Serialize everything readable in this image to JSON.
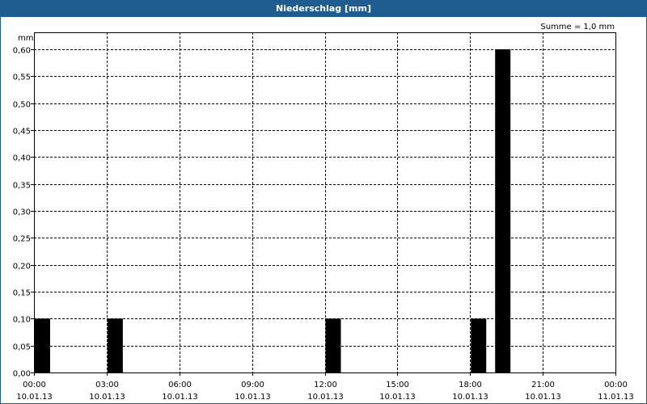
{
  "window": {
    "title": "Niederschlag [mm]"
  },
  "colors": {
    "titlebar": "#1f5d91",
    "bar": "#000000",
    "grid": "#000000"
  },
  "chart_data": {
    "type": "bar",
    "title": "Niederschlag [mm]",
    "ylabel": "mm",
    "annotation": "Summe = 1,0 mm",
    "ylim": [
      0,
      0.6
    ],
    "yticks": [
      "0,00",
      "0,05",
      "0,10",
      "0,15",
      "0,20",
      "0,25",
      "0,30",
      "0,35",
      "0,40",
      "0,45",
      "0,50",
      "0,55",
      "0,60"
    ],
    "xlim_hours": [
      0,
      24
    ],
    "xticks": [
      {
        "time": "00:00",
        "date": "10.01.13"
      },
      {
        "time": "03:00",
        "date": "10.01.13"
      },
      {
        "time": "06:00",
        "date": "10.01.13"
      },
      {
        "time": "09:00",
        "date": "10.01.13"
      },
      {
        "time": "12:00",
        "date": "10.01.13"
      },
      {
        "time": "15:00",
        "date": "10.01.13"
      },
      {
        "time": "18:00",
        "date": "10.01.13"
      },
      {
        "time": "21:00",
        "date": "10.01.13"
      },
      {
        "time": "00:00",
        "date": "11.01.13"
      }
    ],
    "bars": [
      {
        "start": "00:00",
        "end": "00:40",
        "value": 0.1
      },
      {
        "start": "03:00",
        "end": "03:40",
        "value": 0.1
      },
      {
        "start": "12:00",
        "end": "12:40",
        "value": 0.1
      },
      {
        "start": "18:00",
        "end": "18:40",
        "value": 0.1
      },
      {
        "start": "19:00",
        "end": "19:40",
        "value": 0.6
      }
    ],
    "grid": true
  }
}
